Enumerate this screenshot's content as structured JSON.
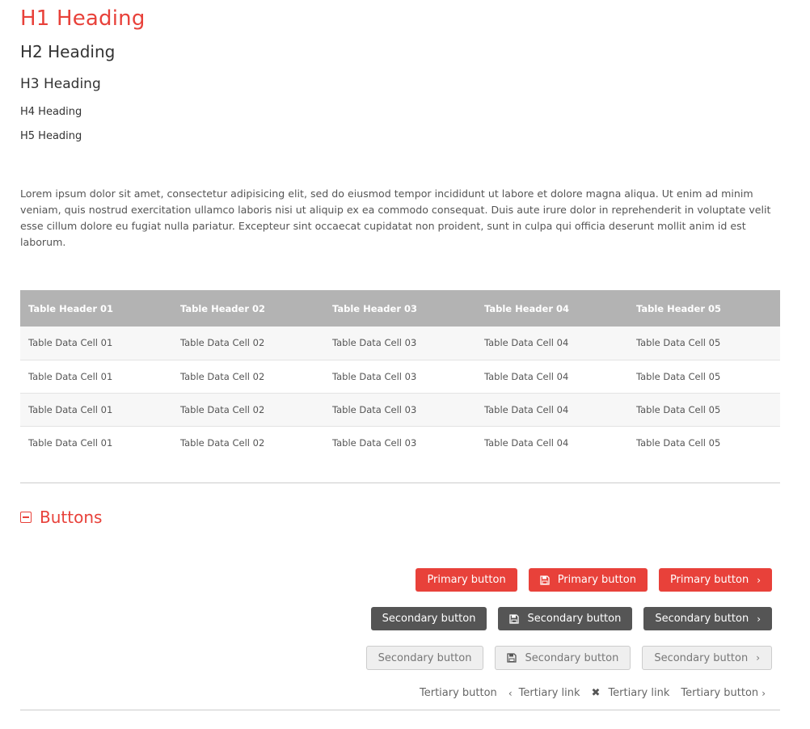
{
  "headings": {
    "h1": "H1 Heading",
    "h2": "H2 Heading",
    "h3": "H3 Heading",
    "h4": "H4 Heading",
    "h5": "H5 Heading"
  },
  "paragraph": "Lorem ipsum dolor sit amet, consectetur adipisicing elit, sed do eiusmod tempor incididunt ut labore et dolore magna aliqua. Ut enim ad minim veniam, quis nostrud exercitation ullamco laboris nisi ut aliquip ex ea commodo consequat. Duis aute irure dolor in reprehenderit in voluptate velit esse cillum dolore eu fugiat nulla pariatur. Excepteur sint occaecat cupidatat non proident, sunt in culpa qui officia deserunt mollit anim id est laborum.",
  "table": {
    "headers": [
      "Table Header 01",
      "Table Header 02",
      "Table Header 03",
      "Table Header 04",
      "Table Header 05"
    ],
    "rows": [
      [
        "Table Data Cell 01",
        "Table Data Cell 02",
        "Table Data Cell 03",
        "Table Data Cell 04",
        "Table Data Cell 05"
      ],
      [
        "Table Data Cell 01",
        "Table Data Cell 02",
        "Table Data Cell 03",
        "Table Data Cell 04",
        "Table Data Cell 05"
      ],
      [
        "Table Data Cell 01",
        "Table Data Cell 02",
        "Table Data Cell 03",
        "Table Data Cell 04",
        "Table Data Cell 05"
      ],
      [
        "Table Data Cell 01",
        "Table Data Cell 02",
        "Table Data Cell 03",
        "Table Data Cell 04",
        "Table Data Cell 05"
      ]
    ]
  },
  "section": {
    "title": "Buttons",
    "icon": "collapse-minus-icon"
  },
  "buttons": {
    "primary": [
      "Primary button",
      "Primary button",
      "Primary button"
    ],
    "secondary_dark": [
      "Secondary button",
      "Secondary button",
      "Secondary button"
    ],
    "secondary_light": [
      "Secondary button",
      "Secondary button",
      "Secondary button"
    ],
    "tertiary": [
      "Tertiary button",
      "Tertiary link",
      "Tertiary link",
      "Tertiary button"
    ]
  },
  "colors": {
    "accent": "#e8413a",
    "dark_button": "#555555",
    "light_button": "#efefef",
    "table_header": "#b3b3b3"
  }
}
